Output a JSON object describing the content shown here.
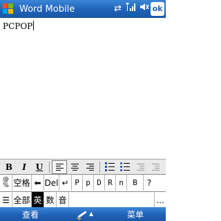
{
  "titlebar": {
    "app_title": "Word Mobile",
    "ok_label": "ok",
    "icons": [
      "windows-start-icon",
      "connectivity-icon",
      "signal-icon",
      "volume-icon"
    ]
  },
  "document": {
    "text": "PCPOP"
  },
  "toolbar": {
    "bold": "B",
    "italic": "I",
    "underline": "U",
    "items": [
      "bold",
      "italic",
      "underline",
      "align-left",
      "align-center",
      "align-right",
      "numbered-list",
      "bulleted-list",
      "decrease-indent",
      "increase-indent"
    ],
    "active": [
      "align-left"
    ]
  },
  "keyboard": {
    "row1": {
      "symbols_top": "@",
      "symbols_bottom": "%",
      "space": "空格",
      "del": "Del",
      "candidates": [
        "P",
        "p",
        "D",
        "R",
        "n",
        "B"
      ],
      "help": "?"
    },
    "row2": {
      "all": "全部",
      "english": "英",
      "digits": "数",
      "sound": "音",
      "more": "..."
    }
  },
  "softkeys": {
    "left": "查看",
    "right": "菜单"
  },
  "colors": {
    "titlebar": "#1f62b8",
    "toolbar": "#e9e9e9",
    "active_key": "#000000"
  }
}
